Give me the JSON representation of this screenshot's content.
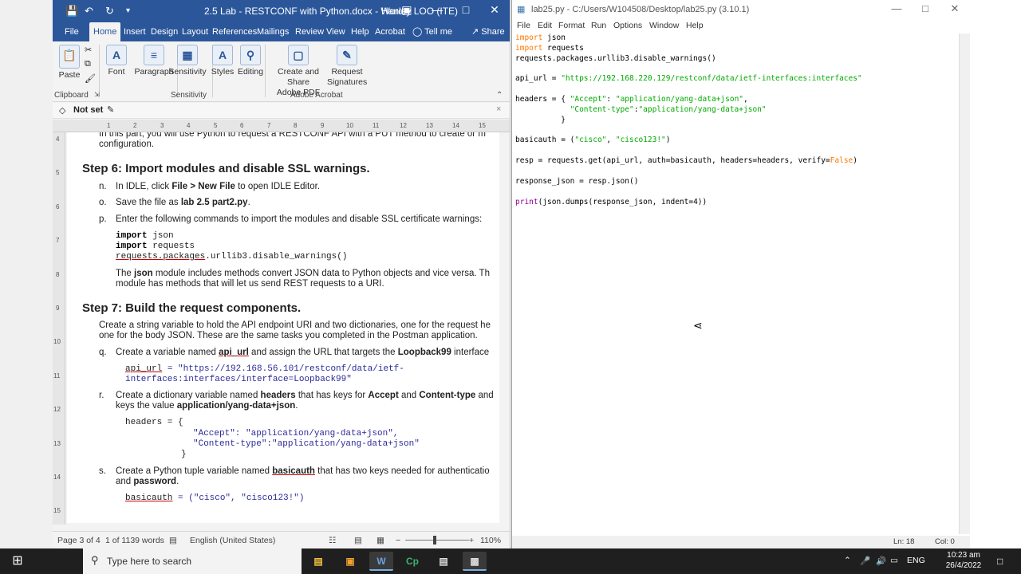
{
  "word": {
    "title": "2.5 Lab - RESTCONF with Python.docx  -  Word",
    "user": "Hanley LOO (ITE)",
    "tabs": [
      "File",
      "Home",
      "Insert",
      "Design",
      "Layout",
      "References",
      "Mailings",
      "Review",
      "View",
      "Help",
      "Acrobat",
      "Tell me",
      "Share"
    ],
    "ribbon": {
      "paste": "Paste",
      "font": "Font",
      "paragraph": "Paragraph",
      "sensitivity": "Sensitivity",
      "styles": "Styles",
      "editing": "Editing",
      "create_share_1": "Create and Share",
      "create_share_2": "Adobe PDF",
      "request_1": "Request",
      "request_2": "Signatures",
      "grp_clipboard": "Clipboard",
      "grp_sensitivity": "Sensitivity",
      "grp_adobe": "Adobe Acrobat"
    },
    "sensitivity_label": "Not set",
    "doc": {
      "top_line_1": "In this part, you will use Python to request a RESTCONF API with a PUT method to create or m",
      "top_line_2": "configuration.",
      "step6": "Step 6: Import modules and disable SSL warnings.",
      "n_label": "n.",
      "n_text_1": "In IDLE, click ",
      "n_bold_1": "File > New File",
      "n_text_2": " to open IDLE Editor.",
      "o_label": "o.",
      "o_text_1": "Save the file as ",
      "o_bold": "lab 2.5 part2.py",
      "o_text_2": ".",
      "p_label": "p.",
      "p_text": "Enter the following commands to import the modules and disable SSL certificate warnings:",
      "code_import1_kw": "import",
      "code_import1_mod": " json",
      "code_import2_kw": "import",
      "code_import2_mod": " requests",
      "code_disable_1": "requests.packages",
      "code_disable_2": ".urllib3.disable_warnings()",
      "json_text_1a": "The ",
      "json_text_1b": "json",
      "json_text_1c": " module includes methods convert JSON data to Python objects and vice versa. Th",
      "json_text_2": "module has methods that will let us send REST requests to a URI.",
      "step7": "Step 7: Build the request components.",
      "create_text_1": "Create a string variable to hold the API endpoint URI and two dictionaries, one for the request he",
      "create_text_2": "one for the body JSON. These are the same tasks you completed in the Postman application.",
      "q_label": "q.",
      "q_text_1": "Create a variable named ",
      "q_bold_1": "api_url",
      "q_text_2": " and assign the URL that targets the ",
      "q_bold_2": "Loopback99",
      "q_text_3": " interface",
      "api_code_1a": "api_url",
      "api_code_1b": " = \"https://192.168.56.101/restconf/data/ietf-",
      "api_code_2": "interfaces:interfaces/interface=Loopback99\"",
      "r_label": "r.",
      "r_text_1": "Create a dictionary variable named ",
      "r_bold_1": "headers",
      "r_text_2": " that has keys for ",
      "r_bold_2": "Accept",
      "r_text_3": " and ",
      "r_bold_3": "Content-type",
      "r_text_4": " and",
      "r_text_5": "keys the value ",
      "r_bold_4": "application/yang-data+json",
      "r_text_6": ".",
      "headers_code_1": "headers = {",
      "headers_code_2": "\"Accept\": \"application/yang-data+json\",",
      "headers_code_3": "\"Content-type\":\"application/yang-data+json\"",
      "headers_code_4": "}",
      "s_label": "s.",
      "s_text_1": "Create a Python tuple variable named ",
      "s_bold_1": "basicauth",
      "s_text_2": " that has two keys needed for authenticatio",
      "s_text_3": "and ",
      "s_bold_2": "password",
      "s_text_4": ".",
      "basic_code_1": "basicauth",
      "basic_code_2": " = (\"cisco\", \"cisco123!\")"
    },
    "status": {
      "page": "Page 3 of 4",
      "words": "1 of 1139 words",
      "language": "English (United States)",
      "zoom": "110%"
    }
  },
  "idle": {
    "title": "lab25.py - C:/Users/W104508/Desktop/lab25.py (3.10.1)",
    "menu": [
      "File",
      "Edit",
      "Format",
      "Run",
      "Options",
      "Window",
      "Help"
    ],
    "status": {
      "line": "Ln: 18",
      "col": "Col: 0"
    }
  },
  "taskbar": {
    "search_placeholder": "Type here to search",
    "language": "ENG",
    "time": "10:23 am",
    "date": "26/4/2022"
  }
}
